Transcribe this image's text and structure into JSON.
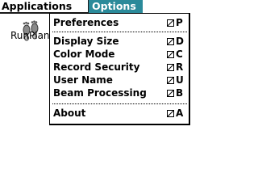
{
  "colors": {
    "menu_highlight": "#2a8a9a",
    "text": "#000000",
    "background": "#ffffff"
  },
  "menubar": {
    "applications_label": "Applications",
    "options_label": "Options"
  },
  "launcher": {
    "app_label": "RunPlan",
    "app_icon": "footprints-icon"
  },
  "options_menu": {
    "shortcut_glyph": "command-stroke-icon",
    "items": [
      {
        "label": "Preferences",
        "key": "P"
      },
      {
        "label": "Display Size",
        "key": "D"
      },
      {
        "label": "Color Mode",
        "key": "C"
      },
      {
        "label": "Record Security",
        "key": "R"
      },
      {
        "label": "User Name",
        "key": "U"
      },
      {
        "label": "Beam Processing",
        "key": "B"
      },
      {
        "label": "About",
        "key": "A"
      }
    ]
  }
}
